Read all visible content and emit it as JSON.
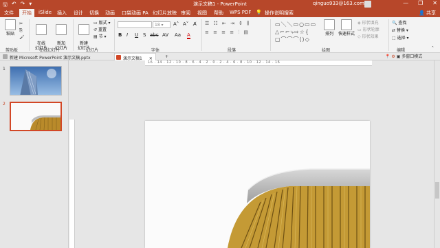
{
  "titlebar": {
    "title": "演示文稿1  -  PowerPoint",
    "account": "qinguo933@163.com",
    "min": "—",
    "restore": "❐",
    "close": "✕"
  },
  "tabs": {
    "items": [
      "文件",
      "开始",
      "iSlide",
      "插入",
      "设计",
      "切换",
      "动画",
      "口袋动画 PA",
      "幻灯片放映",
      "审阅",
      "视图",
      "帮助",
      "WPS PDF",
      "操作说明搜索"
    ],
    "active": "开始",
    "share": "共享"
  },
  "ribbon": {
    "clipboard": {
      "label": "剪贴板",
      "paste": "粘贴"
    },
    "slides_new": {
      "new_slide": "在线\n幻灯片",
      "add_slide": "新加\n幻灯片",
      "online_label": "在线幻灯片"
    },
    "slides": {
      "label": "幻灯片",
      "new": "新建\n幻灯片",
      "layout": "版式",
      "reset": "重置",
      "section": "节"
    },
    "font": {
      "label": "字体",
      "size": "18",
      "bold": "B",
      "italic": "I",
      "underline": "U",
      "strike": "S",
      "shadow": "abc",
      "spacing": "AV",
      "case": "Aa",
      "color": "A"
    },
    "paragraph": {
      "label": "段落"
    },
    "drawing": {
      "label": "绘图",
      "arrange": "排列",
      "quick_styles": "快速样式",
      "fill": "形状填充",
      "outline": "形状轮廓",
      "effects": "形状效果"
    },
    "editing": {
      "label": "编辑",
      "find": "查找",
      "replace": "替换",
      "select": "选择"
    }
  },
  "doctabs": {
    "new_tab": "新建 Microsoft PowerPoint 演示文稿.pptx",
    "active_tab": "演示文稿1",
    "add": "+"
  },
  "quickrow": {
    "multi_window": "多窗口模式"
  },
  "thumbs": [
    {
      "num": "1"
    },
    {
      "num": "2"
    }
  ],
  "ruler": {
    "h": "16 · 14 · 12 · 10 · 8 · 6 · 4 · 2 · 0 · 2 · 4 · 6 · 8 · 10 · 12 · 14 · 16"
  },
  "colors": {
    "accent": "#b7472a",
    "selected_thumb_border": "#d24726"
  }
}
